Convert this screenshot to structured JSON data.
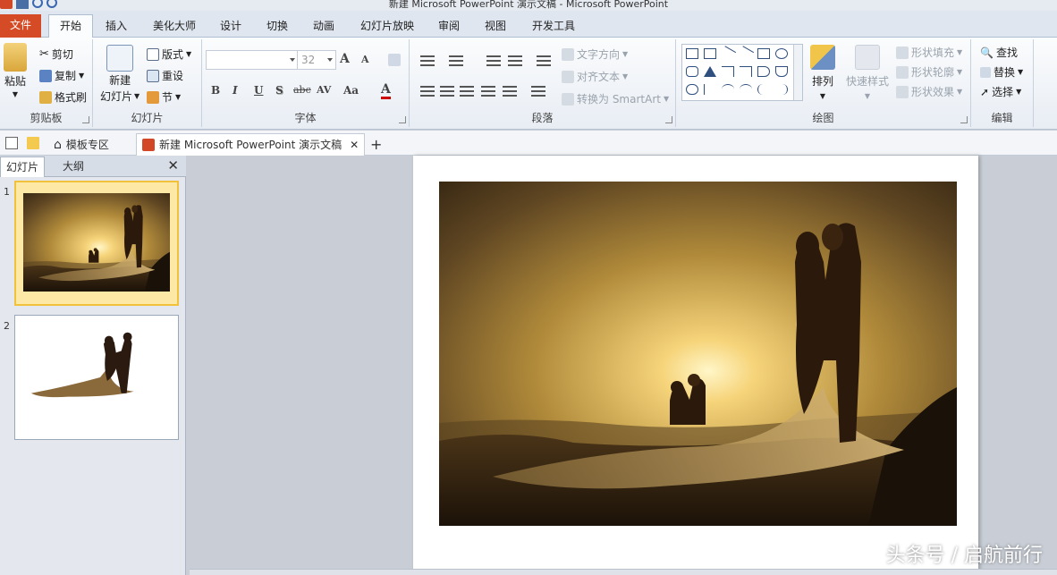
{
  "window": {
    "title": "新建 Microsoft PowerPoint 演示文稿 - Microsoft PowerPoint"
  },
  "tabs": [
    {
      "label": "文件"
    },
    {
      "label": "开始"
    },
    {
      "label": "插入"
    },
    {
      "label": "美化大师"
    },
    {
      "label": "设计"
    },
    {
      "label": "切换"
    },
    {
      "label": "动画"
    },
    {
      "label": "幻灯片放映"
    },
    {
      "label": "审阅"
    },
    {
      "label": "视图"
    },
    {
      "label": "开发工具"
    }
  ],
  "ribbon": {
    "clipboard": {
      "label": "剪贴板",
      "paste": "粘贴",
      "cut": "剪切",
      "copy": "复制",
      "format_painter": "格式刷"
    },
    "slides": {
      "label": "幻灯片",
      "new_slide_1": "新建",
      "new_slide_2": "幻灯片",
      "layout": "版式",
      "reset": "重设",
      "section": "节"
    },
    "font": {
      "label": "字体",
      "font_name": "",
      "font_size": "32",
      "bold": "B",
      "italic": "I",
      "underline": "U",
      "shadow": "S",
      "strike": "abc",
      "spacing": "AV",
      "case": "Aa",
      "color": "A",
      "grow": "A",
      "shrink": "A"
    },
    "paragraph": {
      "label": "段落",
      "text_direction": "文字方向",
      "align_text": "对齐文本",
      "smartart": "转换为 SmartArt"
    },
    "drawing": {
      "label": "绘图",
      "arrange": "排列",
      "quick_styles": "快速样式",
      "shape_fill": "形状填充",
      "shape_outline": "形状轮廓",
      "shape_effects": "形状效果"
    },
    "editing": {
      "label": "编辑",
      "find": "查找",
      "replace": "替换",
      "select": "选择"
    }
  },
  "docbar": {
    "template_tab": "模板专区",
    "doc_tab": "新建 Microsoft PowerPoint 演示文稿",
    "close": "✕",
    "add": "+"
  },
  "panel": {
    "tab_slides": "幻灯片",
    "tab_outline": "大纲",
    "close": "✕",
    "slides": [
      {
        "num": "1"
      },
      {
        "num": "2"
      }
    ]
  },
  "watermark": "头条号 / 启航前行",
  "colors": {
    "file_tab": "#d54b25",
    "accent": "#2b579a",
    "selected_thumb": "#f0c23b"
  }
}
